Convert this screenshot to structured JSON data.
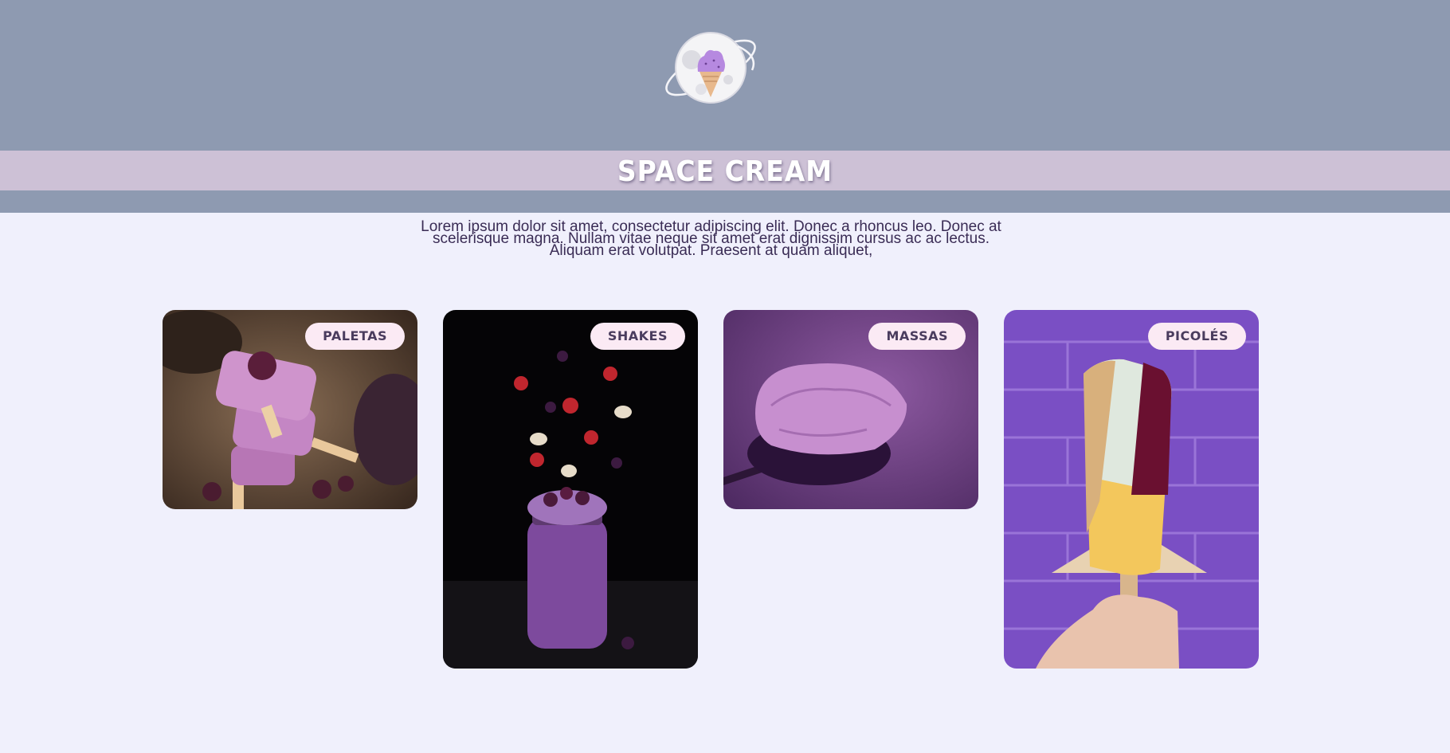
{
  "header": {
    "logo_icon": "ice-cream-planet-icon",
    "title": "SPACE CREAM"
  },
  "intro": {
    "text": "Lorem ipsum dolor sit amet, consectetur adipiscing elit. Donec a rhoncus leo. Donec at scelerisque magna. Nullam vitae neque sit amet erat dignissim cursus ac ac lectus. Aliquam erat volutpat. Praesent at quam aliquet,"
  },
  "categories": [
    {
      "label": "PALETAS"
    },
    {
      "label": "SHAKES"
    },
    {
      "label": "MASSAS"
    },
    {
      "label": "PICOLÉS"
    }
  ],
  "colors": {
    "header_bg": "#8e9ab1",
    "title_band": "#cdc1d6",
    "page_bg": "#f0f0fc",
    "badge_bg": "#fbeaf4",
    "text": "#3a2c55"
  }
}
